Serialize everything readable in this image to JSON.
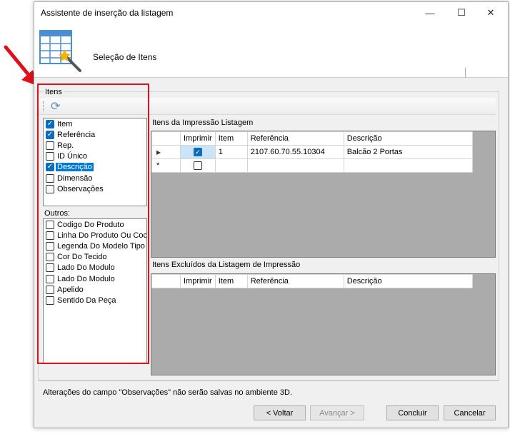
{
  "window": {
    "title": "Assistente de inserção da listagem",
    "minimize_glyph": "—",
    "maximize_glyph": "☐",
    "close_glyph": "✕"
  },
  "header": {
    "subtitle": "Seleção de Itens",
    "icon": "table-wand-icon"
  },
  "group": {
    "label": "Itens"
  },
  "toolbar": {
    "refresh_icon": "refresh-icon",
    "refresh_glyph": "⟳"
  },
  "items_list": [
    {
      "label": "Item",
      "checked": true,
      "selected": false
    },
    {
      "label": "Referência",
      "checked": true,
      "selected": false
    },
    {
      "label": "Rep.",
      "checked": false,
      "selected": false
    },
    {
      "label": "ID Único",
      "checked": false,
      "selected": false
    },
    {
      "label": "Descrição",
      "checked": true,
      "selected": true
    },
    {
      "label": "Dimensão",
      "checked": false,
      "selected": false
    },
    {
      "label": "Observações",
      "checked": false,
      "selected": false
    }
  ],
  "outros": {
    "label": "Outros:",
    "items": [
      {
        "label": "Codigo Do Produto",
        "checked": false
      },
      {
        "label": "Linha Do Produto Ou Coc",
        "checked": false
      },
      {
        "label": "Legenda Do Modelo Tipo",
        "checked": false
      },
      {
        "label": "Cor Do Tecido",
        "checked": false
      },
      {
        "label": "Lado Do Modulo",
        "checked": false
      },
      {
        "label": "Lado Do Modulo",
        "checked": false
      },
      {
        "label": "Apelido",
        "checked": false
      },
      {
        "label": "Sentido Da Peça",
        "checked": false
      }
    ]
  },
  "print_grid": {
    "label": "Itens da Impressão Listagem",
    "columns": [
      "Imprimir",
      "Item",
      "Referência",
      "Descrição"
    ],
    "rows": [
      {
        "indicator": "▶",
        "imprimir": true,
        "item": "1",
        "referencia": "2107.60.70.55.10304",
        "descricao": "Balcão 2 Portas"
      }
    ],
    "new_row_indicator": "*"
  },
  "excluded_grid": {
    "label": "Itens Excluídos da Listagem de Impressão",
    "columns": [
      "Imprimir",
      "Item",
      "Referência",
      "Descrição"
    ]
  },
  "status": {
    "text": "Alterações do campo \"Observações\" não serão salvas no ambiente 3D."
  },
  "buttons": {
    "back": "< Voltar",
    "next": "Avançar >",
    "finish": "Concluir",
    "cancel": "Cancelar"
  },
  "colors": {
    "annotation_red": "#e0101a",
    "selection_blue": "#0078d7",
    "checkbox_blue": "#0f6cbd"
  },
  "check_glyph": "✓"
}
